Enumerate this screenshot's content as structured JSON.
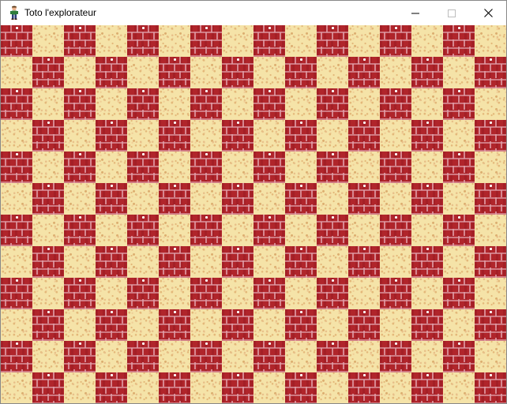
{
  "window": {
    "title": "Toto l'explorateur",
    "icon": "explorer-character-icon",
    "controls": {
      "minimize": "minimize-icon",
      "maximize": "maximize-icon",
      "close": "close-icon"
    }
  },
  "game": {
    "map_rows": [
      "BSBSBSBSBSBSBSBS",
      "SBSBSBSBSBSBSBSB",
      "BSBSBSBSBSBSBSBS",
      "SBSBSBSBSBSBSBSB",
      "BSBSBSBSBSBSBSBS",
      "SBSBSBSBSBSBSBSB",
      "BSBSBSBSBSBSBSBS",
      "SBSBSBSBSBSBSBSB",
      "BSBSBSBSBSBSBSBS",
      "SBSBSBSBSBSBSBSB",
      "BSBSBSBSBSBSBSBS",
      "SBSBSBSBSBSBSBSB"
    ],
    "tile_legend": {
      "B": "brick-wall",
      "S": "sand-floor"
    },
    "colors": {
      "brick": "#b0252b",
      "mortar": "#dc96a0",
      "sand": "#f5e3a8",
      "sand_speckle": "#e3b87a"
    }
  }
}
